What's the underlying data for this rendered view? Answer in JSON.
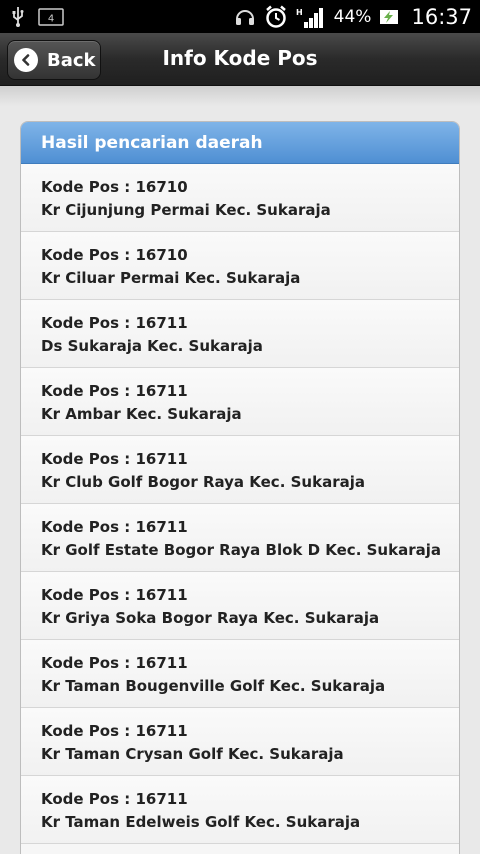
{
  "status_bar": {
    "battery_percent": "44%",
    "time": "16:37",
    "icons": [
      "usb-icon",
      "sd-card-icon",
      "headset-icon",
      "alarm-icon",
      "signal-icon",
      "battery-charging-icon"
    ]
  },
  "header": {
    "back_label": "Back",
    "title": "Info Kode Pos"
  },
  "list": {
    "header": "Hasil pencarian daerah",
    "items": [
      {
        "code": "Kode Pos : 16710",
        "area": "Kr Cijunjung Permai Kec. Sukaraja"
      },
      {
        "code": "Kode Pos : 16710",
        "area": "Kr Ciluar Permai Kec. Sukaraja"
      },
      {
        "code": "Kode Pos : 16711",
        "area": "Ds Sukaraja Kec. Sukaraja"
      },
      {
        "code": "Kode Pos : 16711",
        "area": "Kr Ambar Kec. Sukaraja"
      },
      {
        "code": "Kode Pos : 16711",
        "area": "Kr Club Golf Bogor Raya Kec. Sukaraja"
      },
      {
        "code": "Kode Pos : 16711",
        "area": "Kr Golf Estate Bogor Raya Blok D Kec. Sukaraja"
      },
      {
        "code": "Kode Pos : 16711",
        "area": "Kr Griya Soka Bogor Raya Kec. Sukaraja"
      },
      {
        "code": "Kode Pos : 16711",
        "area": "Kr Taman Bougenville Golf Kec. Sukaraja"
      },
      {
        "code": "Kode Pos : 16711",
        "area": "Kr Taman Crysan Golf Kec. Sukaraja"
      },
      {
        "code": "Kode Pos : 16711",
        "area": "Kr Taman Edelweis Golf Kec. Sukaraja"
      }
    ]
  },
  "colors": {
    "accent": "#4f8fd3",
    "header_bg": "#2a2a2a"
  }
}
